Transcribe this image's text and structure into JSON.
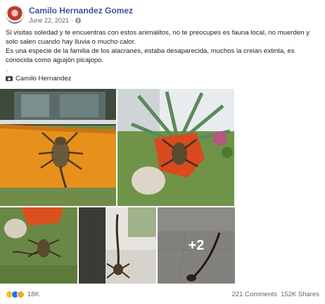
{
  "post": {
    "author": "Camilo Hernandez Gomez",
    "date": "June 22, 2021",
    "separator": "·",
    "privacy_icon": "globe-icon",
    "paragraphs": [
      "Si visitas soledad y te encuentras con estos animalitos, no te preocupes es fauna local, no muerden y solo salen cuando hay lluvia o mucho calor.",
      "Es una especie de la familia de los alacranes, estaba desaparecida, muchos la creian extinta, es conocida como aguijón picajopo.",
      "."
    ],
    "credit_icon": "camera-icon",
    "credit": "Camilo Hernandez",
    "more_photos": "+2",
    "reactions": {
      "icons": [
        "haha-icon",
        "like-icon",
        "wow-icon"
      ],
      "count": "18K"
    },
    "comments": "221 Comments",
    "shares": "152K Shares"
  }
}
